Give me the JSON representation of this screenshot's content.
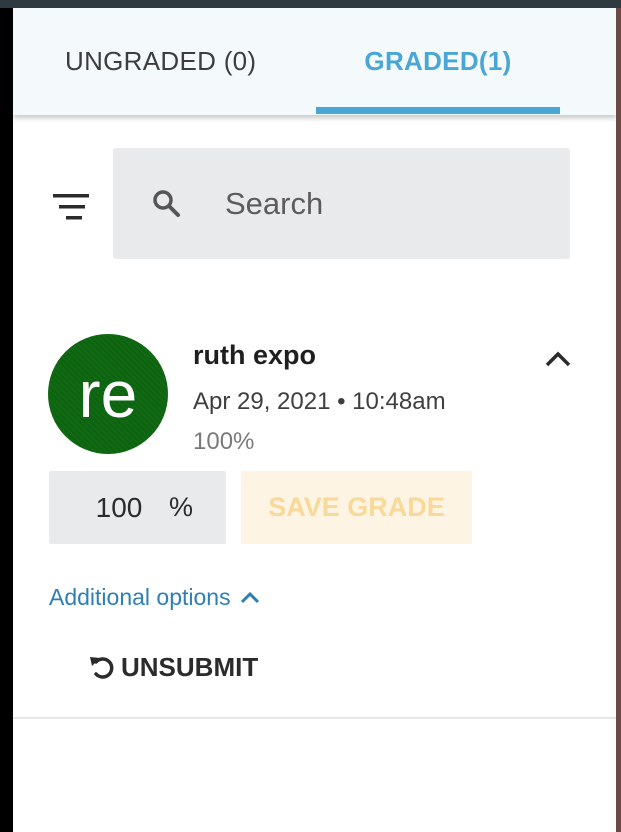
{
  "tabs": [
    {
      "label": "UNGRADED (0)",
      "active": false
    },
    {
      "label": "GRADED(1)",
      "active": true
    }
  ],
  "search": {
    "placeholder": "Search",
    "value": ""
  },
  "student": {
    "initials": "re",
    "name": "ruth expo",
    "submitted_at": "Apr 29, 2021 • 10:48am",
    "score": "100%",
    "avatar_color": "#0f6a12"
  },
  "grade": {
    "value": "100",
    "unit": "%",
    "save_label": "SAVE GRADE"
  },
  "options": {
    "additional_label": "Additional options",
    "unsubmit_label": "UNSUBMIT"
  },
  "icons": {
    "filter": "filter-icon",
    "search": "search-icon",
    "collapse": "chevron-up-icon",
    "unsubmit": "undo-icon"
  },
  "colors": {
    "accent": "#4aa6d4",
    "link": "#2f7fb5",
    "save_disabled_bg": "#fdf4e4",
    "save_disabled_text": "#f8d99a"
  }
}
